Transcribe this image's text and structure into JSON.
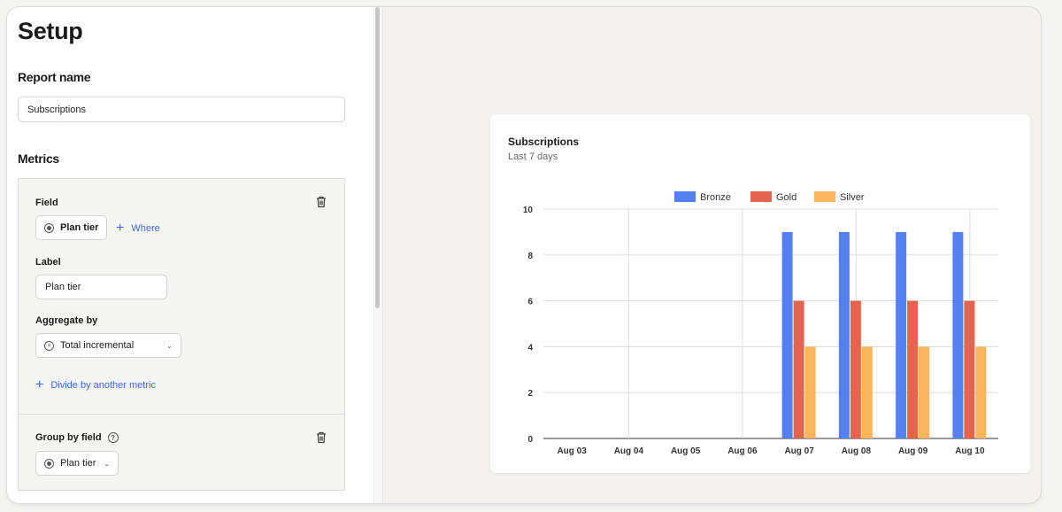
{
  "setup": {
    "title": "Setup",
    "report_name_heading": "Report name",
    "report_name_value": "Subscriptions",
    "metrics_heading": "Metrics"
  },
  "metric": {
    "field_label": "Field",
    "field_value": "Plan tier",
    "where_link": "Where",
    "label_label": "Label",
    "label_value": "Plan tier",
    "aggregate_label": "Aggregate by",
    "aggregate_value": "Total incremental",
    "divide_link": "Divide by another metric",
    "group_label": "Group by field",
    "group_value": "Plan tier"
  },
  "icons": {
    "radio": "radio-icon",
    "trash": "trash-icon",
    "plus": "plus-icon",
    "help": "help-icon",
    "equals": "equals-circle-icon",
    "chevron": "chevron-down-icon"
  },
  "chart_data": {
    "type": "bar",
    "title": "Subscriptions",
    "subtitle": "Last 7 days",
    "categories": [
      "Aug 03",
      "Aug 04",
      "Aug 05",
      "Aug 06",
      "Aug 07",
      "Aug 08",
      "Aug 09",
      "Aug 10"
    ],
    "series": [
      {
        "name": "Bronze",
        "color": "#5580f0",
        "values": [
          0,
          0,
          0,
          0,
          9,
          9,
          9,
          9
        ]
      },
      {
        "name": "Gold",
        "color": "#e3654f",
        "values": [
          0,
          0,
          0,
          0,
          6,
          6,
          6,
          6
        ]
      },
      {
        "name": "Silver",
        "color": "#fbb55c",
        "values": [
          0,
          0,
          0,
          0,
          4,
          4,
          4,
          4
        ]
      }
    ],
    "ylim": [
      0,
      10
    ],
    "yticks": [
      0,
      2,
      4,
      6,
      8,
      10
    ],
    "grid": true,
    "legend": "top-center"
  }
}
